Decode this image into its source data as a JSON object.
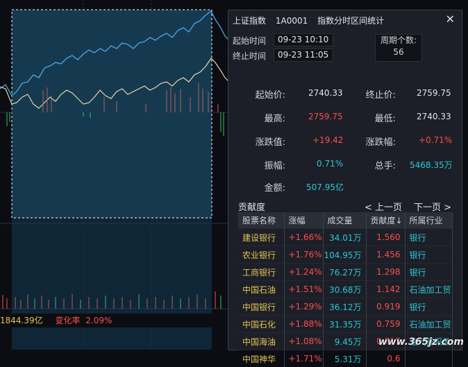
{
  "chart": {
    "amount": "1844.39亿",
    "change_label": "变化率",
    "change_value": "2.09%"
  },
  "panel": {
    "title_market": "上证指数",
    "title_code": "1A0001",
    "title_desc": "指数分时区间统计",
    "close_icon": "close-icon",
    "start_label": "起始时间",
    "start_value": "09-23 10:10",
    "end_label": "终止时间",
    "end_value": "09-23 11:05",
    "period_label": "周期个数:",
    "period_value": "56"
  },
  "stats": {
    "open_label": "起始价:",
    "open_value": "2740.33",
    "close_label": "终止价:",
    "close_value": "2759.75",
    "high_label": "最高:",
    "high_value": "2759.75",
    "low_label": "最低:",
    "low_value": "2740.33",
    "chg_label": "涨跌值:",
    "chg_value": "+19.42",
    "chgpct_label": "涨跌幅:",
    "chgpct_value": "+0.71%",
    "amp_label": "振幅:",
    "amp_value": "0.71%",
    "hand_label": "总手:",
    "hand_value": "5468.35万",
    "amt_label": "金额:",
    "amt_value": "507.95亿"
  },
  "contrib": {
    "tab_label": "贡献度",
    "prev_label": "< 上一页",
    "next_label": "下一页 >",
    "columns": [
      "股票名称",
      "涨幅",
      "成交量",
      "贡献度↓",
      "所属行业"
    ],
    "rows": [
      [
        "建设银行",
        "+1.66%",
        "34.01万",
        "1.560",
        "银行"
      ],
      [
        "农业银行",
        "+1.76%",
        "104.95万",
        "1.456",
        "银行"
      ],
      [
        "工商银行",
        "+1.24%",
        "76.27万",
        "1.298",
        "银行"
      ],
      [
        "中国石油",
        "+1.51%",
        "30.68万",
        "1.142",
        "石油加工贸"
      ],
      [
        "中国银行",
        "+1.29%",
        "36.12万",
        "0.919",
        "银行"
      ],
      [
        "中国石化",
        "+1.88%",
        "31.35万",
        "0.759",
        "石油加工贸"
      ],
      [
        "中国海油",
        "+1.08%",
        "9.45万",
        "0.717",
        "油气开采及"
      ],
      [
        "中国神华",
        "+1.71%",
        "5.31万",
        "0.6",
        ""
      ]
    ]
  },
  "watermark": "www.365jz.com"
}
